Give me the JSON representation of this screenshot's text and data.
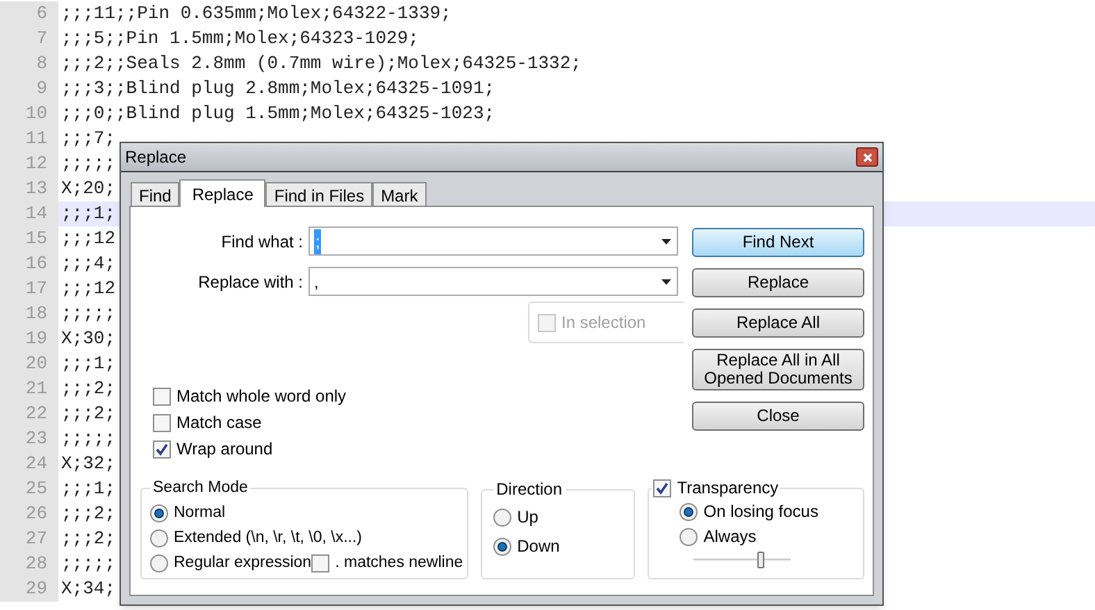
{
  "editor": {
    "lines": [
      {
        "number": "6",
        "text": ";;;11;;Pin 0.635mm;Molex;64322-1339;",
        "current": false
      },
      {
        "number": "7",
        "text": ";;;5;;Pin 1.5mm;Molex;64323-1029;",
        "current": false
      },
      {
        "number": "8",
        "text": ";;;2;;Seals 2.8mm (0.7mm wire);Molex;64325-1332;",
        "current": false
      },
      {
        "number": "9",
        "text": ";;;3;;Blind plug 2.8mm;Molex;64325-1091;",
        "current": false
      },
      {
        "number": "10",
        "text": ";;;0;;Blind plug 1.5mm;Molex;64325-1023;",
        "current": false
      },
      {
        "number": "11",
        "text": ";;;7;",
        "current": false
      },
      {
        "number": "12",
        "text": ";;;;;",
        "current": false
      },
      {
        "number": "13",
        "text": "X;20;",
        "current": false
      },
      {
        "number": "14",
        "text": ";;;1;",
        "current": true
      },
      {
        "number": "15",
        "text": ";;;12",
        "current": false
      },
      {
        "number": "16",
        "text": ";;;4;",
        "current": false
      },
      {
        "number": "17",
        "text": ";;;12",
        "current": false
      },
      {
        "number": "18",
        "text": ";;;;;",
        "current": false
      },
      {
        "number": "19",
        "text": "X;30;",
        "current": false
      },
      {
        "number": "20",
        "text": ";;;1;",
        "current": false
      },
      {
        "number": "21",
        "text": ";;;2;",
        "current": false
      },
      {
        "number": "22",
        "text": ";;;2;",
        "current": false
      },
      {
        "number": "23",
        "text": ";;;;;",
        "current": false
      },
      {
        "number": "24",
        "text": "X;32;",
        "current": false
      },
      {
        "number": "25",
        "text": ";;;1;",
        "current": false
      },
      {
        "number": "26",
        "text": ";;;2;",
        "current": false
      },
      {
        "number": "27",
        "text": ";;;2;",
        "current": false
      },
      {
        "number": "28",
        "text": ";;;;;",
        "current": false
      },
      {
        "number": "29",
        "text": "X;34;",
        "current": false
      }
    ]
  },
  "dialog": {
    "title": "Replace",
    "tabs": [
      {
        "label": "Find",
        "selected": false
      },
      {
        "label": "Replace",
        "selected": true
      },
      {
        "label": "Find in Files",
        "selected": false
      },
      {
        "label": "Mark",
        "selected": false
      }
    ],
    "find_what": {
      "label": "Find what :",
      "value": ";",
      "highlighted": true
    },
    "replace_with": {
      "label": "Replace with :",
      "value": ",",
      "highlighted": false
    },
    "in_selection": {
      "label": "In selection",
      "checked": false,
      "disabled": true
    },
    "buttons": [
      {
        "label": "Find Next",
        "default": true
      },
      {
        "label": "Replace",
        "default": false
      },
      {
        "label": "Replace All",
        "default": false
      },
      {
        "label": "Replace All in All Opened Documents",
        "default": false
      },
      {
        "label": "Close",
        "default": false
      }
    ],
    "options": [
      {
        "label": "Match whole word only",
        "checked": false
      },
      {
        "label": "Match case",
        "checked": false
      },
      {
        "label": "Wrap around",
        "checked": true
      }
    ],
    "search_mode": {
      "title": "Search Mode",
      "options": [
        {
          "label": "Normal",
          "selected": true
        },
        {
          "label": "Extended (\\n, \\r, \\t, \\0, \\x...)",
          "selected": false
        },
        {
          "label": "Regular expression",
          "selected": false
        }
      ],
      "dot_matches_newline": {
        "label": ". matches newline",
        "checked": false
      }
    },
    "direction": {
      "title": "Direction",
      "options": [
        {
          "label": "Up",
          "selected": false
        },
        {
          "label": "Down",
          "selected": true
        }
      ]
    },
    "transparency": {
      "label": "Transparency",
      "checked": true,
      "options": [
        {
          "label": "On losing focus",
          "selected": true
        },
        {
          "label": "Always",
          "selected": false
        }
      ],
      "level": 0.7
    }
  }
}
